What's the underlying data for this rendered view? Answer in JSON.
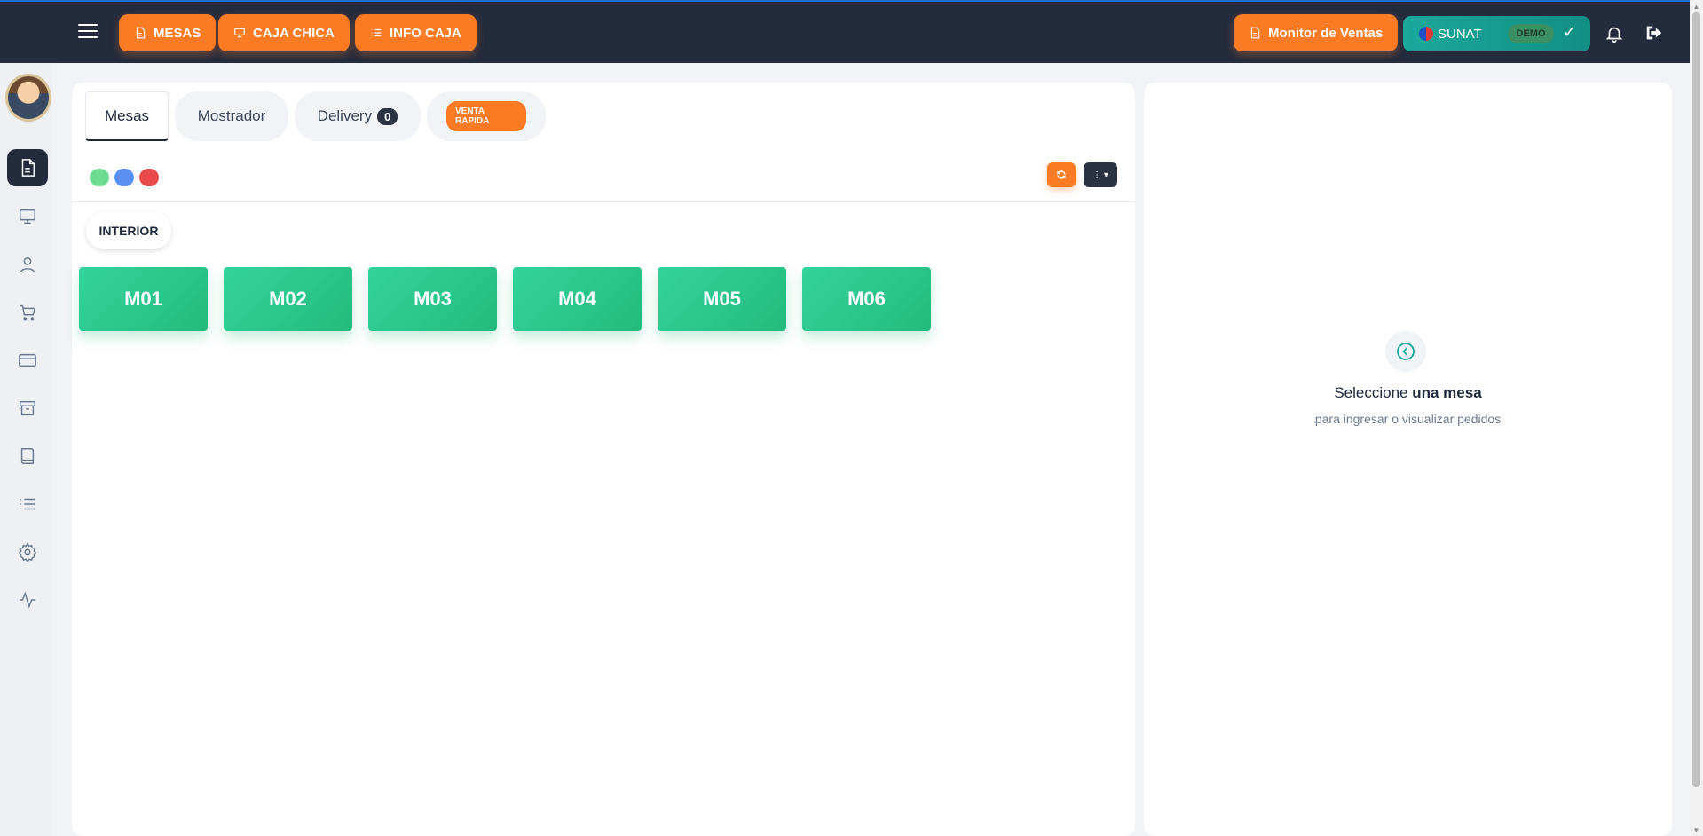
{
  "topbar": {
    "buttons": [
      {
        "label": "MESAS",
        "icon": "document-icon"
      },
      {
        "label": "CAJA CHICA",
        "icon": "monitor-icon"
      },
      {
        "label": "INFO CAJA",
        "icon": "list-icon"
      }
    ],
    "monitor_label": "Monitor de Ventas",
    "sunat": {
      "label": "SUNAT",
      "badge": "DEMO",
      "check": "✓"
    }
  },
  "tabs": {
    "mesas": "Mesas",
    "mostrador": "Mostrador",
    "delivery": "Delivery",
    "delivery_count": "0",
    "venta_rapida": "VENTA RAPIDA"
  },
  "legend_colors": [
    "#6fdc93",
    "#5b8ff2",
    "#e84b4b"
  ],
  "zone": "INTERIOR",
  "mesas": [
    "M01",
    "M02",
    "M03",
    "M04",
    "M05",
    "M06"
  ],
  "right_panel": {
    "title_normal": "Seleccione",
    "title_bold": "una mesa",
    "subtitle": "para ingresar o visualizar pedidos"
  },
  "colors": {
    "accent": "#fb7a24",
    "navbar": "#232b3d",
    "table_green": "#2cc78c",
    "sunat": "#1aa89b"
  }
}
